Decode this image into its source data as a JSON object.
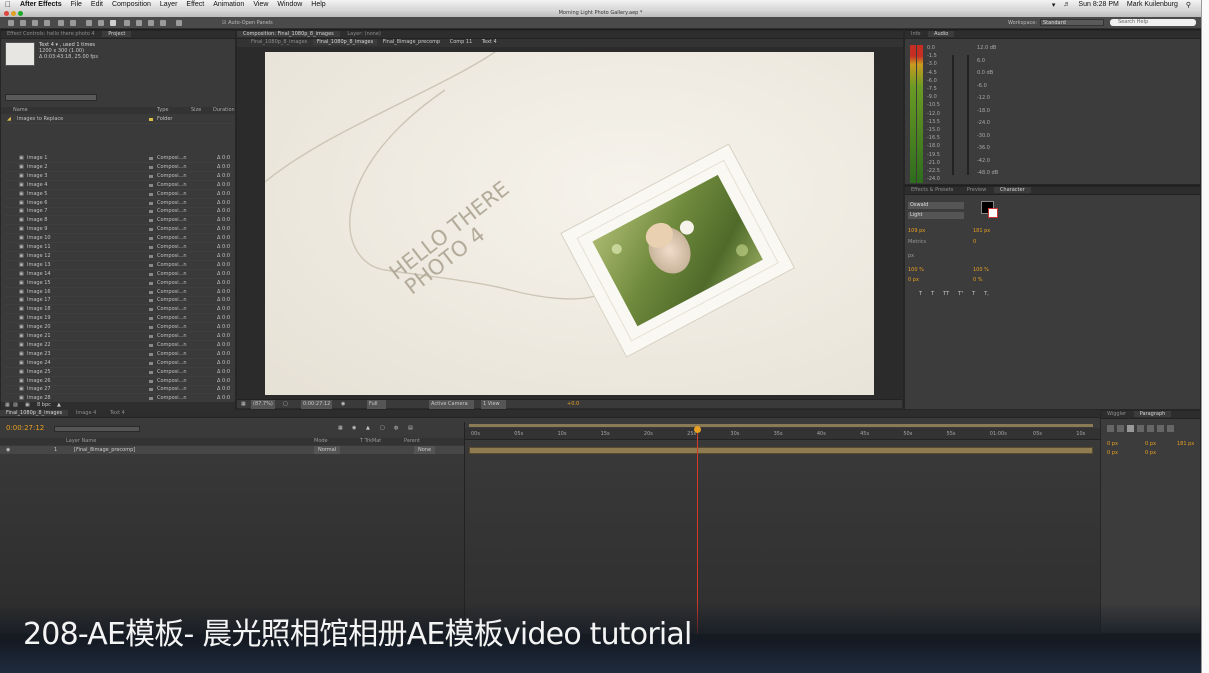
{
  "menubar": {
    "app": "After Effects",
    "items": [
      "File",
      "Edit",
      "Composition",
      "Layer",
      "Effect",
      "Animation",
      "View",
      "Window",
      "Help"
    ],
    "clock": "Sun 8:28 PM",
    "user": "Mark Kuilenburg"
  },
  "window_title": "Morning Light Photo Gallery.aep *",
  "toolbar": {
    "auto_open": "Auto-Open Panels",
    "workspace_label": "Workspace:",
    "workspace_value": "Standard",
    "search_placeholder": "Search Help"
  },
  "project_panel": {
    "tabs": [
      "Effect Controls: hello there photo 4",
      "Project"
    ],
    "selected_name": "Text 4 ▾ , used 1 times",
    "selected_dims": "1200 x 300 (1.00)",
    "selected_dur": "Δ 0:03:43:18, 25.00 fps",
    "columns": {
      "name": "Name",
      "type": "Type",
      "size": "Size",
      "duration": "Duration"
    },
    "folder": {
      "name": "Images to Replace",
      "type": "Folder"
    },
    "items": [
      "Image 1",
      "Image 2",
      "Image 3",
      "Image 4",
      "Image 5",
      "Image 6",
      "Image 7",
      "Image 8",
      "Image 9",
      "Image 10",
      "Image 11",
      "Image 12",
      "Image 13",
      "Image 14",
      "Image 15",
      "Image 16",
      "Image 17",
      "Image 18",
      "Image 19",
      "Image 20",
      "Image 21",
      "Image 22",
      "Image 23",
      "Image 24",
      "Image 25",
      "Image 26",
      "Image 27",
      "Image 28",
      "Image 29",
      "Image 30",
      "Image 31"
    ],
    "item_type": "Composi...n",
    "item_duration": "Δ 0:0",
    "bpc": "8 bpc"
  },
  "composition": {
    "tabs": [
      "Composition: Final_1080p_8_images",
      "Layer: (none)"
    ],
    "subtabs": [
      "Final_1080p_8_images",
      "Final_8image_precomp",
      "Comp 11",
      "Text 4"
    ],
    "frame_text": [
      "HELLO THERE",
      "PHOTO 4"
    ],
    "footer": {
      "zoom": "(87.7%)",
      "timecode": "0:00:27:12",
      "res": "Full",
      "camera": "Active Camera",
      "view": "1 View",
      "offset": "+0.0"
    }
  },
  "info_audio": {
    "tabs": [
      "Info",
      "Audio"
    ],
    "left_scale": [
      "0.0",
      "-1.5",
      "-3.0",
      "-4.5",
      "-6.0",
      "-7.5",
      "-9.0",
      "-10.5",
      "-12.0",
      "-13.5",
      "-15.0",
      "-16.5",
      "-18.0",
      "-19.5",
      "-21.0",
      "-22.5",
      "-24.0"
    ],
    "right_scale": [
      "12.0 dB",
      "6.0",
      "0.0 dB",
      "-6.0",
      "-12.0",
      "-18.0",
      "-24.0",
      "-30.0",
      "-36.0",
      "-42.0",
      "-48.0 dB"
    ]
  },
  "character_panel": {
    "tabs": [
      "Effects & Presets",
      "Preview",
      "Character"
    ],
    "font": "Oswald",
    "style": "Light",
    "size": "109 px",
    "leading": "181 px",
    "tracking": "0",
    "metrics": "Metrics",
    "unit": "px",
    "vscale": "100 %",
    "hscale": "100 %",
    "baseline": "0 px",
    "tsume": "0 %",
    "style_buttons": [
      "T",
      "T",
      "TT",
      "Tᵀ",
      "T",
      "T,"
    ]
  },
  "timeline": {
    "tabs": [
      "Final_1080p_8_images",
      "Image 4",
      "Text 4"
    ],
    "timecode": "0:00:27:12",
    "columns": {
      "layer": "Layer Name",
      "mode": "Mode",
      "trkmat": "T TrkMat",
      "parent": "Parent"
    },
    "layer": {
      "index": "1",
      "name": "[Final_8image_precomp]",
      "mode": "Normal",
      "parent": "None"
    },
    "ruler": [
      "00s",
      "05s",
      "10s",
      "15s",
      "20s",
      "25s",
      "30s",
      "35s",
      "40s",
      "45s",
      "50s",
      "55s",
      "01:00s",
      "05s",
      "10s"
    ],
    "playhead_fraction": 0.366,
    "toggle": "Toggle Switches / Modes"
  },
  "paragraph_panel": {
    "tabs": [
      "Wiggler",
      "Paragraph"
    ],
    "fields": [
      "0 px",
      "0 px",
      "181 px",
      "0 px",
      "0 px"
    ]
  },
  "caption": "208-AE模板- 晨光照相馆相册AE模板video tutorial",
  "accent": {
    "timecode": "#e8a020",
    "playhead": "#d23a2a",
    "work_area": "#8a7a55"
  }
}
